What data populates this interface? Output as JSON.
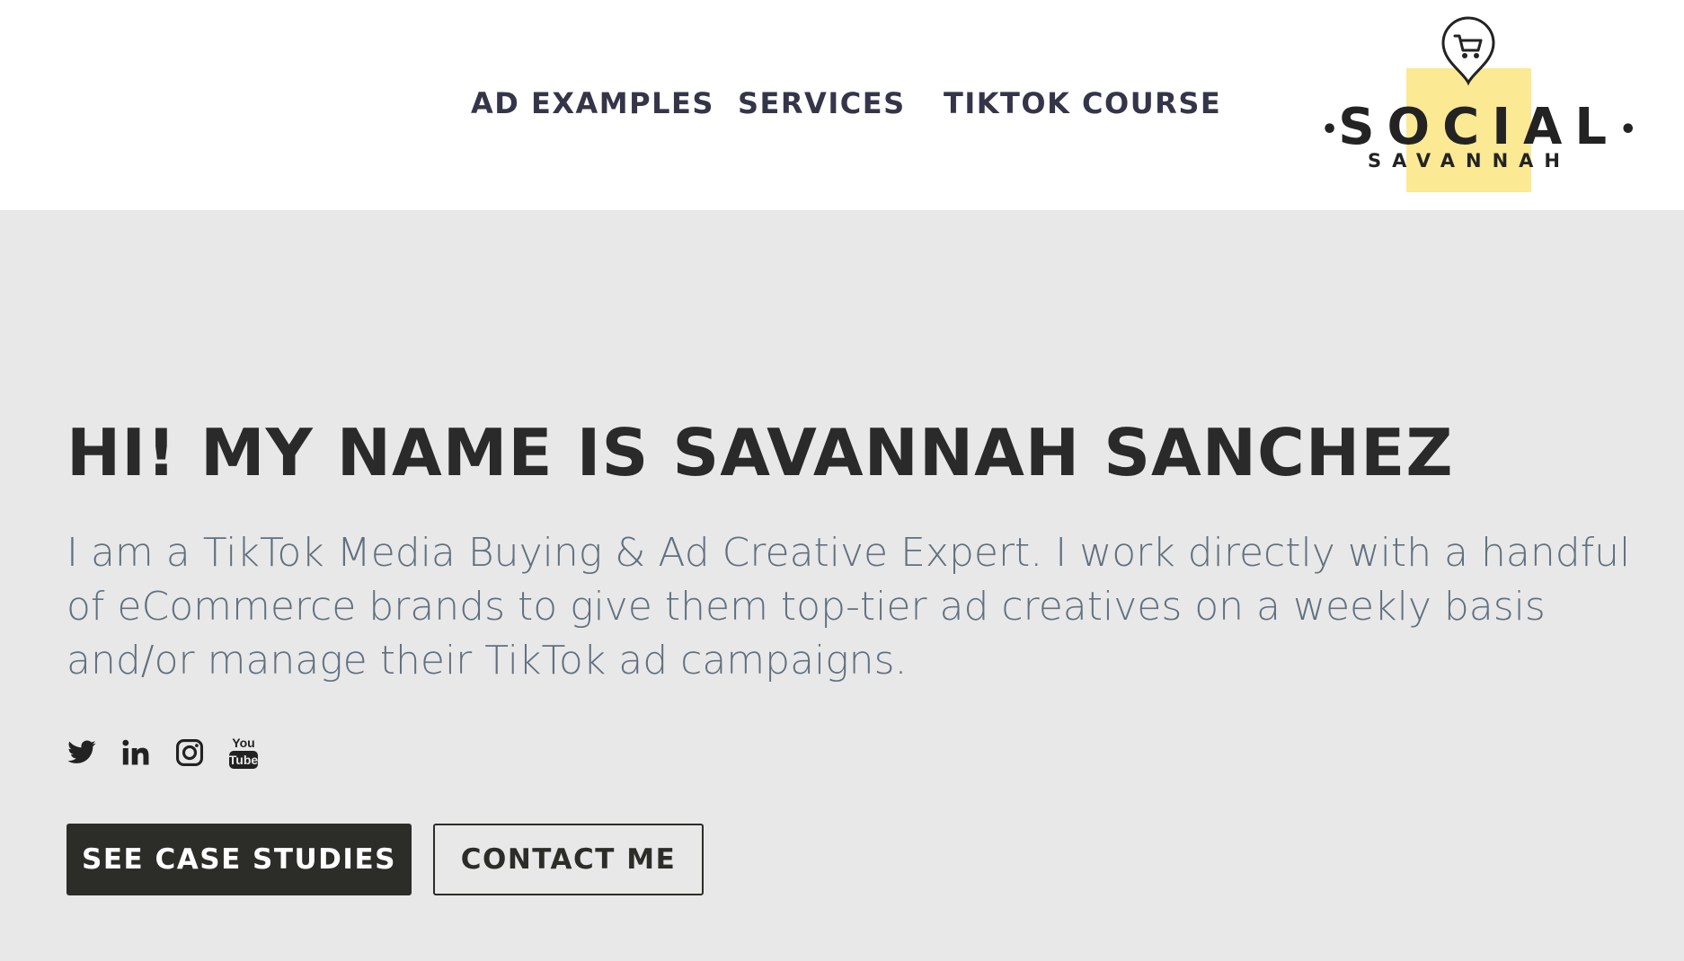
{
  "nav": {
    "items": [
      {
        "label": "AD EXAMPLES"
      },
      {
        "label": "SERVICES"
      },
      {
        "label": "TIKTOK COURSE"
      }
    ]
  },
  "logo": {
    "word": "SOCIAL",
    "sub": "SAVANNAH",
    "icon": "shopping-cart-pin-icon",
    "highlight_color": "#fbe993"
  },
  "hero": {
    "title": "HI! MY NAME IS SAVANNAH SANCHEZ",
    "description": "I am a TikTok Media Buying & Ad Creative Expert. I work directly with a handful of eCommerce brands to give them top-tier ad creatives on a weekly basis and/or manage their TikTok ad campaigns.",
    "social_icons": [
      "twitter-icon",
      "linkedin-icon",
      "instagram-icon",
      "youtube-icon"
    ],
    "youtube_icon_text": {
      "top": "You",
      "bottom": "Tube"
    },
    "buttons": {
      "primary": "SEE CASE STUDIES",
      "secondary": "CONTACT ME"
    }
  },
  "colors": {
    "background": "#e8e8e8",
    "header": "#ffffff",
    "nav_text": "#35354a",
    "title_text": "#2a2a2a",
    "body_text": "#607080",
    "button_dark": "#2c2c28"
  }
}
